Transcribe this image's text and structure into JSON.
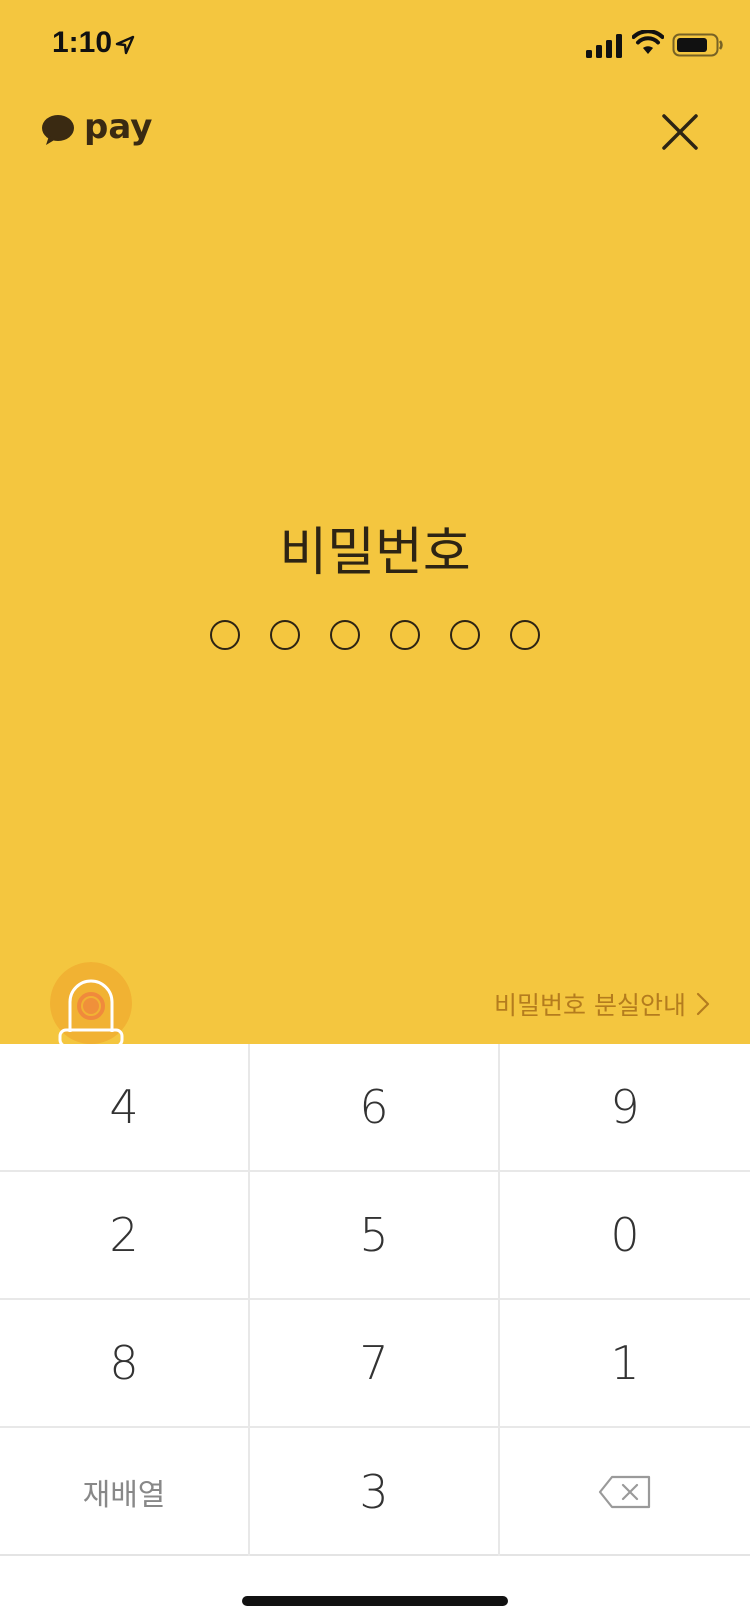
{
  "status_bar": {
    "time": "1:10"
  },
  "header": {
    "logo_text": "pay"
  },
  "main": {
    "title": "비밀번호",
    "pin_length": 6,
    "pin_dots": [
      "",
      "",
      "",
      "",
      "",
      ""
    ]
  },
  "footer_link": {
    "label": "비밀번호 분실안내"
  },
  "keypad": {
    "rows": [
      [
        "4",
        "6",
        "9"
      ],
      [
        "2",
        "5",
        "0"
      ],
      [
        "8",
        "7",
        "1"
      ]
    ],
    "bottom": {
      "shuffle_label": "재배열",
      "center": "3"
    }
  },
  "colors": {
    "background_top": "#f4c63f",
    "fingerprint_accent": "#f08a3c",
    "link_text": "#b47c1e"
  }
}
